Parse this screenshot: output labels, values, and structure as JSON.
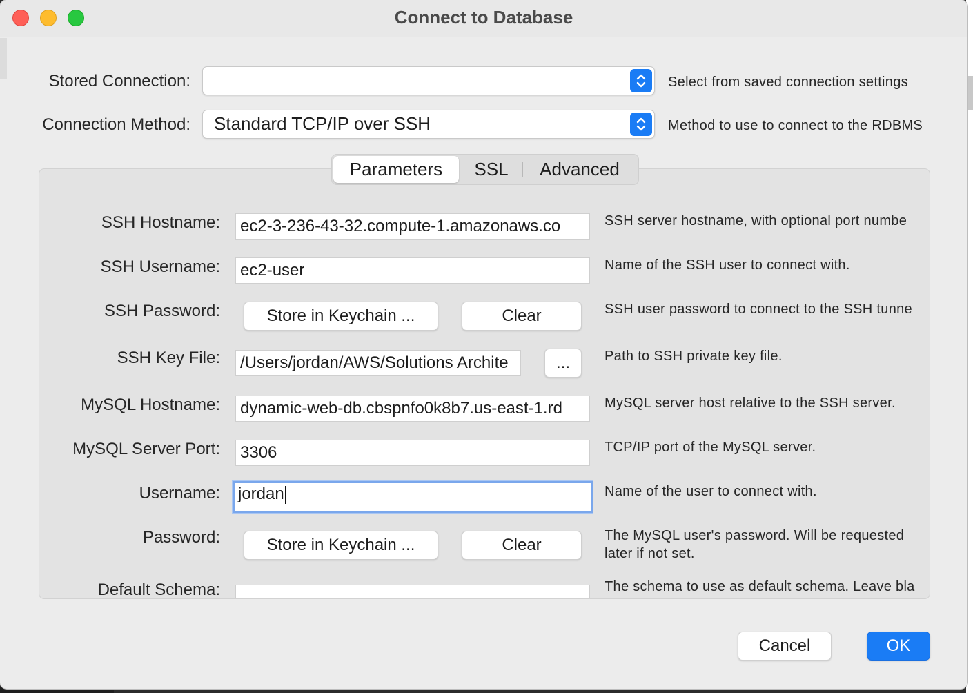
{
  "window": {
    "title": "Connect to Database"
  },
  "stored_connection": {
    "label": "Stored Connection:",
    "value": "",
    "hint": "Select from saved connection settings"
  },
  "connection_method": {
    "label": "Connection Method:",
    "value": "Standard TCP/IP over SSH",
    "hint": "Method to use to connect to the RDBMS"
  },
  "tabs": [
    {
      "label": "Parameters",
      "active": true
    },
    {
      "label": "SSL",
      "active": false
    },
    {
      "label": "Advanced",
      "active": false
    }
  ],
  "params": {
    "ssh_hostname": {
      "label": "SSH Hostname:",
      "value": "ec2-3-236-43-32.compute-1.amazonaws.co",
      "hint": "SSH server hostname, with  optional port numbe"
    },
    "ssh_username": {
      "label": "SSH Username:",
      "value": "ec2-user",
      "hint": "Name of the SSH user to connect with."
    },
    "ssh_password": {
      "label": "SSH Password:",
      "store_button": "Store in Keychain ...",
      "clear_button": "Clear",
      "hint": "SSH user password to connect to the SSH tunne"
    },
    "ssh_key_file": {
      "label": "SSH Key File:",
      "value": "/Users/jordan/AWS/Solutions Archite",
      "browse_button": "...",
      "hint": "Path to SSH private key file."
    },
    "mysql_hostname": {
      "label": "MySQL Hostname:",
      "value": "dynamic-web-db.cbspnfo0k8b7.us-east-1.rd",
      "hint": "MySQL server host relative to the SSH server."
    },
    "mysql_port": {
      "label": "MySQL Server Port:",
      "value": "3306",
      "hint": "TCP/IP port of the MySQL server."
    },
    "username": {
      "label": "Username:",
      "value": "jordan",
      "hint": "Name of the user to connect with."
    },
    "password": {
      "label": "Password:",
      "store_button": "Store in Keychain ...",
      "clear_button": "Clear",
      "hint_line1": "The MySQL user's password. Will be requested",
      "hint_line2": "later if not set."
    },
    "default_schema": {
      "label": "Default Schema:",
      "value": "",
      "hint": "The schema to use as default schema. Leave bla"
    }
  },
  "footer": {
    "cancel": "Cancel",
    "ok": "OK"
  }
}
